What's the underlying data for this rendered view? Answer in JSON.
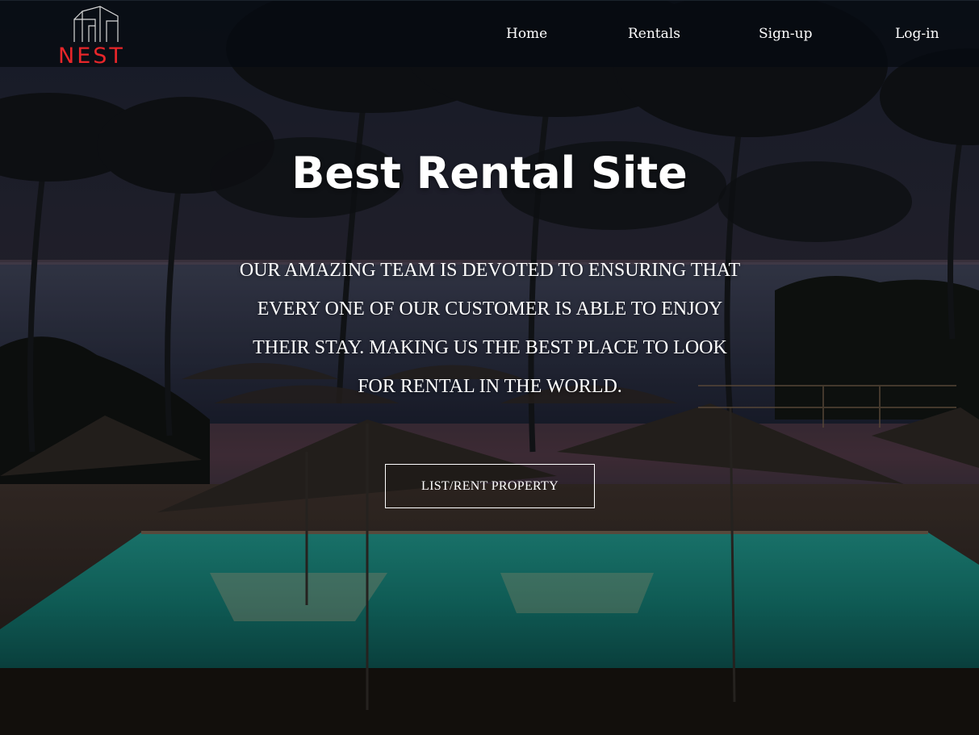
{
  "brand": {
    "name": "NEST",
    "accent_color": "#e8262a",
    "logo_icon": "house-outline-icon"
  },
  "nav": {
    "items": [
      {
        "label": "Home"
      },
      {
        "label": "Rentals"
      },
      {
        "label": "Sign-up"
      },
      {
        "label": "Log-in"
      }
    ]
  },
  "hero": {
    "title": "Best Rental Site",
    "description": "Our amazing team is devoted to ensuring that every one of our customer is able to enjoy their stay. Making us the best place to look for rental in the world.",
    "cta_label": "LIST/RENT PROPERTY",
    "background": "night-resort-pool-with-palm-trees"
  }
}
